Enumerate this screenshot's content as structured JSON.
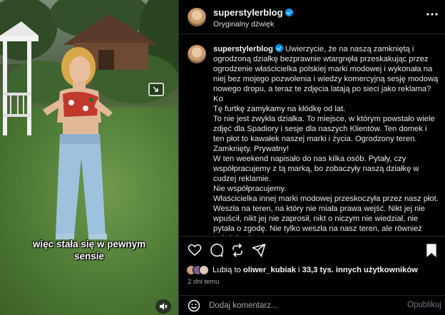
{
  "header": {
    "username": "superstylerblog",
    "subtitle": "Oryginalny dźwięk",
    "more_icon": "more-horizontal-icon"
  },
  "video": {
    "caption_line1": "więc stała się w pewnym",
    "caption_line2": "sensie",
    "pip_icon": "picture-in-picture-icon",
    "mute_icon": "speaker-muted-icon"
  },
  "post": {
    "username": "superstylerblog",
    "paragraphs": [
      "Uwierzycie, że na naszą zamkniętą i ogrodzoną działkę bezprawnie wtargnęła przeskakując przez ogrodzenie właścicielka polskiej marki modowej i wykonała na niej bez mojego pozwolenia i wiedzy komercyjną sesję modową nowego dropu, a teraz te zdjęcia latają po sieci jako reklama?",
      "Ko",
      "Tę furtkę zamykamy na kłódkę od lat.",
      "To nie jest zwykła działka. To miejsce, w którym powstało wiele zdjęć dla Spadiory i sesje dla naszych Klientów. Ten domek i ten płot to kawałek naszej marki i życia. Ogrodzony teren. Zamknięty. Prywatny!",
      "W ten weekend napisało do nas kilka osób. Pytały, czy współpracujemy z tą marką, bo zobaczyły naszą działkę w cudzej reklamie.",
      "Nie współpracujemy.",
      "Właścicielka innej marki modowej przeskoczyła przez nasz płot. Weszła na teren, na który nie miała prawa wejść. Nikt jej nie wpuścił, nikt jej nie zaprosił, nikt o niczym nie wiedział, nie pytała o zgodę. Nie tylko weszła na nasz teren, ale również położyła się"
    ]
  },
  "actions": {
    "like_icon": "heart-icon",
    "comment_icon": "comment-icon",
    "share_icon": "repost-icon",
    "send_icon": "send-icon",
    "save_icon": "bookmark-icon"
  },
  "likes": {
    "prefix": "Lubią to ",
    "user": "oliwer_kubiak",
    "middle": " i ",
    "count": "33,3 tys. innych użytkowników"
  },
  "date": "2 dni temu",
  "comment_box": {
    "placeholder": "Dodaj komentarz...",
    "publish_label": "Opublikuj",
    "emoji_icon": "emoji-icon"
  }
}
